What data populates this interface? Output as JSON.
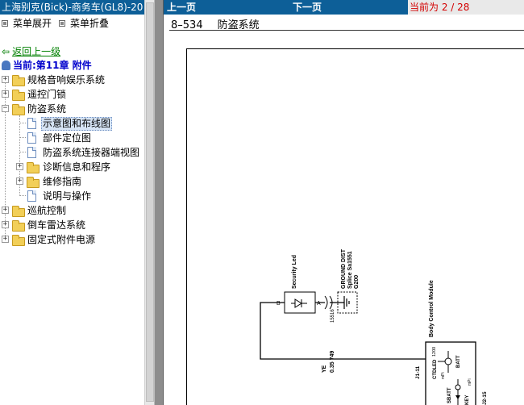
{
  "left_panel": {
    "title": "上海别克(Bick)-商务车(GL8)-20",
    "expand_menu": "菜单展开",
    "collapse_menu": "菜单折叠",
    "back_link": "返回上一级",
    "current": "当前:第11章 附件",
    "tree": [
      {
        "label": "规格音响娱乐系统"
      },
      {
        "label": "遥控门锁"
      },
      {
        "label": "防盗系统"
      },
      {
        "label": "示意图和布线图"
      },
      {
        "label": "部件定位图"
      },
      {
        "label": "防盗系统连接器端视图"
      },
      {
        "label": "诊断信息和程序"
      },
      {
        "label": "维修指南"
      },
      {
        "label": "说明与操作"
      },
      {
        "label": "巡航控制"
      },
      {
        "label": "倒车雷达系统"
      },
      {
        "label": "固定式附件电源"
      }
    ]
  },
  "right_panel": {
    "prev_page": "上一页",
    "next_page": "下一页",
    "page_indicator": "当前为 2 / 28",
    "doc_number": "8–534",
    "doc_title": "防盗系统",
    "diagram": {
      "security_led": "Security Led",
      "pin_b": "B",
      "pin_a": "A",
      "ground_dist_1": "GROUND DIST",
      "ground_dist_2": "Splice Sa1551",
      "ground_dist_3": "G200",
      "ground_ref": "15516",
      "wire_color": "YE",
      "wire_gauge": "0.35 749",
      "connector": "J1-11",
      "bcm": "Body Control Module",
      "ctdled": "CTDLED",
      "ctdled_num": "1200",
      "batt": "BATT",
      "sbatt": "SBATT",
      "key": "KEY",
      "mpi_1": "mPi",
      "mpi_2": "mPi",
      "j2_15": "J2-15"
    }
  }
}
